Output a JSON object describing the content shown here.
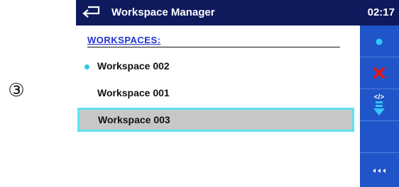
{
  "step_marker": "③",
  "titlebar": {
    "title": "Workspace Manager",
    "clock": "02:17",
    "back_icon": "back-arrow-icon"
  },
  "workspaces": {
    "header": "WORKSPACES:",
    "items": [
      {
        "label": "Workspace 002",
        "active": true,
        "selected": false
      },
      {
        "label": "Workspace 001",
        "active": false,
        "selected": false
      },
      {
        "label": "Workspace 003",
        "active": false,
        "selected": true
      }
    ]
  },
  "sidebar": {
    "buttons": [
      {
        "icon": "open-dot-icon"
      },
      {
        "icon": "delete-x-icon"
      },
      {
        "icon": "export-download-icon"
      },
      {
        "icon": "empty"
      },
      {
        "icon": "more-options-icon",
        "label": "◂◂◂"
      }
    ]
  },
  "colors": {
    "titlebar_bg": "#0e1a5c",
    "sidebar_bg": "#1f55c8",
    "header_text": "#1f2fd0",
    "active_dot": "#27c7e8",
    "selection_border": "#5ee3ee",
    "selection_bg": "#c7c7c7",
    "delete_icon": "#e3171b"
  }
}
